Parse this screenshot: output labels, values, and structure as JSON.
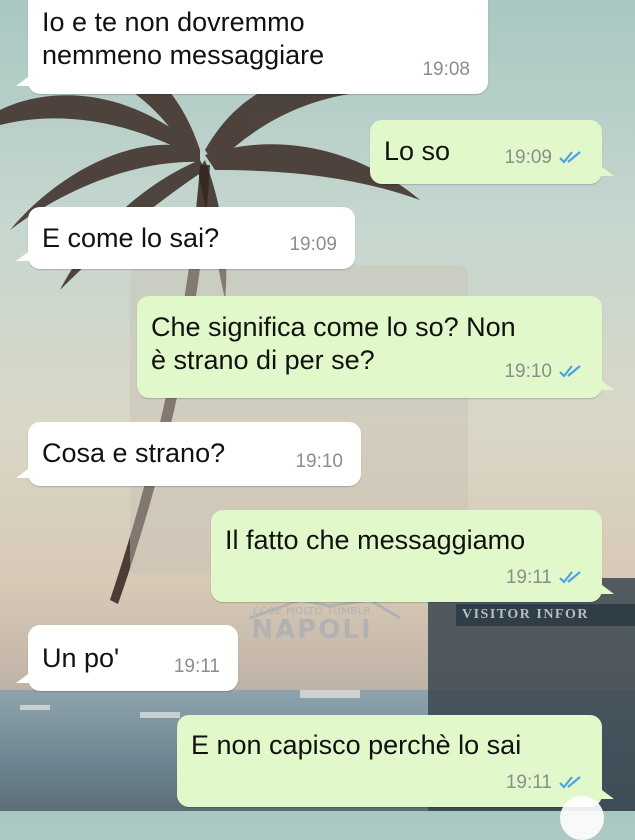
{
  "chat": {
    "messages": [
      {
        "direction": "incoming",
        "lines": "Io e te non dovremmo\nnemmeno messaggiare",
        "time": "19:08"
      },
      {
        "direction": "outgoing",
        "lines": "Lo so",
        "time": "19:09",
        "status": "read"
      },
      {
        "direction": "incoming",
        "lines": "E come lo sai?",
        "time": "19:09"
      },
      {
        "direction": "outgoing",
        "lines": "Che significa come lo so? Non\nè strano di per se?",
        "time": "19:10",
        "status": "read"
      },
      {
        "direction": "incoming",
        "lines": "Cosa e strano?",
        "time": "19:10"
      },
      {
        "direction": "outgoing",
        "lines": "Il fatto che messaggiamo",
        "time": "19:11",
        "status": "read"
      },
      {
        "direction": "incoming",
        "lines": "Un po'",
        "time": "19:11"
      },
      {
        "direction": "outgoing",
        "lines": "E non capisco perchè lo sai",
        "time": "19:11",
        "status": "read"
      }
    ]
  },
  "wallpaper": {
    "watermark_small": "COSE MOLTO TUMBLR",
    "watermark_big": "NAPOLI",
    "sign_text": "VISITOR INFOR"
  },
  "colors": {
    "incoming_bubble": "#ffffff",
    "outgoing_bubble": "#e1f8cb",
    "read_ticks": "#4fa3e0",
    "timestamp": "#8a8f8a"
  }
}
